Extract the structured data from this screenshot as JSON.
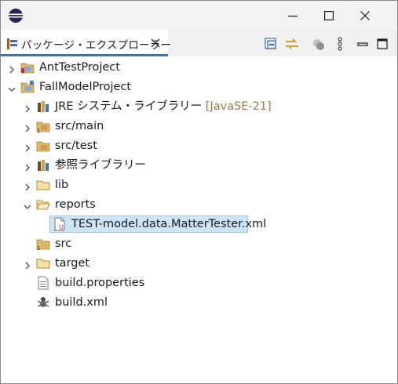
{
  "window": {
    "controls": {
      "minimize_icon": "minimize-icon",
      "maximize_icon": "maximize-icon",
      "close_icon": "close-icon"
    }
  },
  "view": {
    "tab_title": "パッケージ・エクスプローラー",
    "toolbar": [
      "collapse-all-icon",
      "link-with-editor-icon",
      "filter-icon",
      "view-menu-icon",
      "minimize-view-icon",
      "maximize-view-icon"
    ]
  },
  "tree": {
    "items": [
      {
        "label": "AntTestProject",
        "decoration": "",
        "expanded": false,
        "icon": "project-icon"
      },
      {
        "label": "FallModelProject",
        "decoration": "",
        "expanded": true,
        "icon": "project-icon"
      },
      {
        "label": "JRE システム・ライブラリー",
        "decoration": "[JavaSE-21]",
        "expanded": false,
        "icon": "library-icon"
      },
      {
        "label": "src/main",
        "decoration": "",
        "expanded": false,
        "icon": "package-folder-icon"
      },
      {
        "label": "src/test",
        "decoration": "",
        "expanded": false,
        "icon": "source-folder-icon"
      },
      {
        "label": "参照ライブラリー",
        "decoration": "",
        "expanded": false,
        "icon": "library-icon"
      },
      {
        "label": "lib",
        "decoration": "",
        "expanded": false,
        "icon": "folder-icon"
      },
      {
        "label": "reports",
        "decoration": "",
        "expanded": true,
        "icon": "folder-open-icon"
      },
      {
        "label": "TEST-model.data.MatterTester.xml",
        "decoration": "",
        "selected": true,
        "icon": "junit-xml-file-icon"
      },
      {
        "label": "src",
        "decoration": "",
        "icon": "source-package-icon"
      },
      {
        "label": "target",
        "decoration": "",
        "expanded": false,
        "icon": "folder-icon"
      },
      {
        "label": "build.properties",
        "decoration": "",
        "icon": "properties-file-icon"
      },
      {
        "label": "build.xml",
        "decoration": "",
        "icon": "ant-xml-file-icon"
      }
    ]
  },
  "colors": {
    "selection_fill": "#cce4f7",
    "selection_border": "#99c9ef",
    "tab_underline": "#3b73b9",
    "decoration_text": "#9b7a43",
    "folder": "#dcb869"
  }
}
